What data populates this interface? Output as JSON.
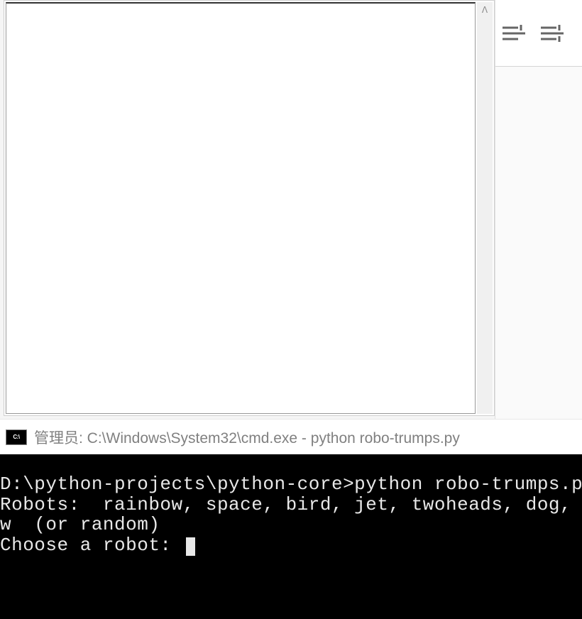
{
  "titlebar": {
    "icon_label": "C:\\",
    "text": "管理员: C:\\Windows\\System32\\cmd.exe - python  robo-trumps.py"
  },
  "terminal": {
    "line1": "D:\\python-projects\\python-core>python robo-trumps.py",
    "line2": "Robots:  rainbow, space, bird, jet, twoheads, dog, round, b",
    "line3": "w  (or random)",
    "line4": "Choose a robot: "
  },
  "toolbar": {
    "icon1_name": "list-icon",
    "icon2_name": "numbered-list-icon"
  },
  "scrollbar": {
    "up_arrow": "ᐱ"
  }
}
